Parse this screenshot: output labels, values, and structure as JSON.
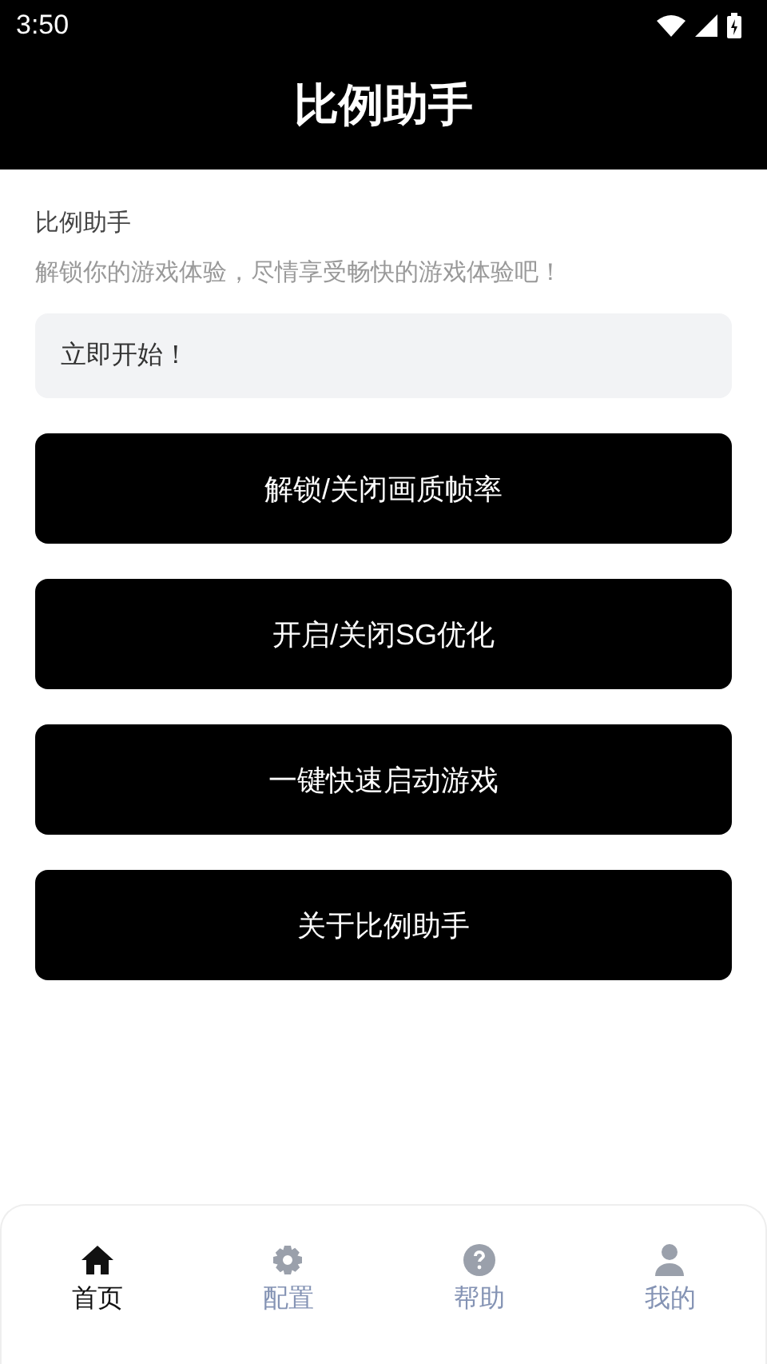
{
  "status_bar": {
    "time": "3:50"
  },
  "header": {
    "title": "比例助手"
  },
  "intro": {
    "title": "比例助手",
    "subtitle": "解锁你的游戏体验，尽情享受畅快的游戏体验吧！"
  },
  "start_banner": {
    "label": "立即开始！"
  },
  "actions": [
    "解锁/关闭画质帧率",
    "开启/关闭SG优化",
    "一键快速启动游戏",
    "关于比例助手"
  ],
  "tabs": [
    {
      "kind": "home",
      "label": "首页",
      "selected": true
    },
    {
      "kind": "settings",
      "label": "配置",
      "selected": false
    },
    {
      "kind": "help",
      "label": "帮助",
      "selected": false
    },
    {
      "kind": "user",
      "label": "我的",
      "selected": false
    }
  ]
}
